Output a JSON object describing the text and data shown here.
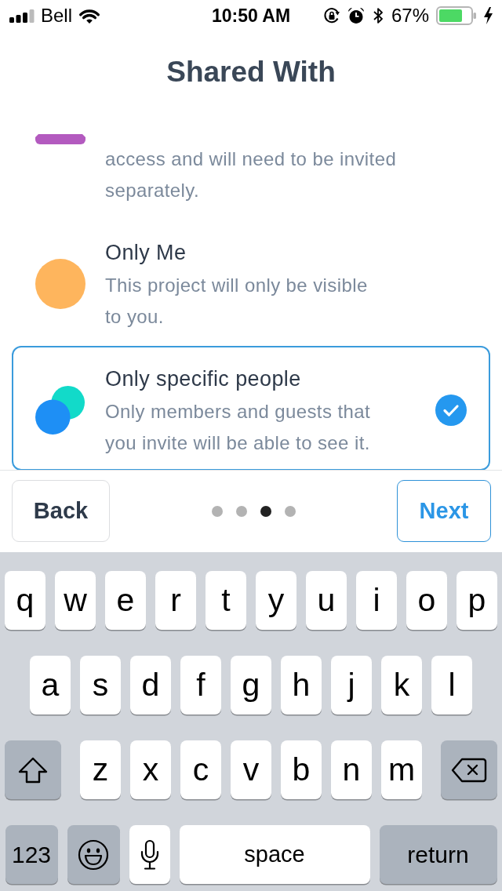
{
  "status_bar": {
    "carrier": "Bell",
    "time": "10:50 AM",
    "battery": "67%"
  },
  "header": {
    "title": "Shared With"
  },
  "options": [
    {
      "kind": "strip",
      "description": "access and will need to be invited\nseparately.",
      "selected": false
    },
    {
      "kind": "circle",
      "title": "Only Me",
      "description": "This project will only be visible\nto you.",
      "selected": false
    },
    {
      "kind": "pair",
      "title": "Only specific people",
      "description": "Only members and guests that\nyou invite will be able to see it.",
      "selected": true
    }
  ],
  "footer": {
    "back": "Back",
    "pages": [
      {
        "selected": false
      },
      {
        "selected": false
      },
      {
        "selected": true
      },
      {
        "selected": false
      }
    ],
    "next": "Next"
  },
  "keyboard": {
    "rows": [
      {
        "keys": [
          {
            "kind": "letter",
            "label": "q"
          },
          {
            "kind": "letter",
            "label": "w"
          },
          {
            "kind": "letter",
            "label": "e"
          },
          {
            "kind": "letter",
            "label": "r"
          },
          {
            "kind": "letter",
            "label": "t"
          },
          {
            "kind": "letter",
            "label": "y"
          },
          {
            "kind": "letter",
            "label": "u"
          },
          {
            "kind": "letter",
            "label": "i"
          },
          {
            "kind": "letter",
            "label": "o"
          },
          {
            "kind": "letter",
            "label": "p"
          }
        ]
      },
      {
        "keys": [
          {
            "kind": "letter",
            "label": "a"
          },
          {
            "kind": "letter",
            "label": "s"
          },
          {
            "kind": "letter",
            "label": "d"
          },
          {
            "kind": "letter",
            "label": "f"
          },
          {
            "kind": "letter",
            "label": "g"
          },
          {
            "kind": "letter",
            "label": "h"
          },
          {
            "kind": "letter",
            "label": "j"
          },
          {
            "kind": "letter",
            "label": "k"
          },
          {
            "kind": "letter",
            "label": "l"
          }
        ]
      },
      {
        "keys": [
          {
            "kind": "shift"
          },
          {
            "kind": "letter",
            "label": "z"
          },
          {
            "kind": "letter",
            "label": "x"
          },
          {
            "kind": "letter",
            "label": "c"
          },
          {
            "kind": "letter",
            "label": "v"
          },
          {
            "kind": "letter",
            "label": "b"
          },
          {
            "kind": "letter",
            "label": "n"
          },
          {
            "kind": "letter",
            "label": "m"
          },
          {
            "kind": "delete"
          }
        ]
      },
      {
        "keys": [
          {
            "kind": "numbers",
            "label": "123"
          },
          {
            "kind": "emoji"
          },
          {
            "kind": "mic"
          },
          {
            "kind": "space",
            "label": "space"
          },
          {
            "kind": "return",
            "label": "return"
          }
        ]
      }
    ]
  }
}
